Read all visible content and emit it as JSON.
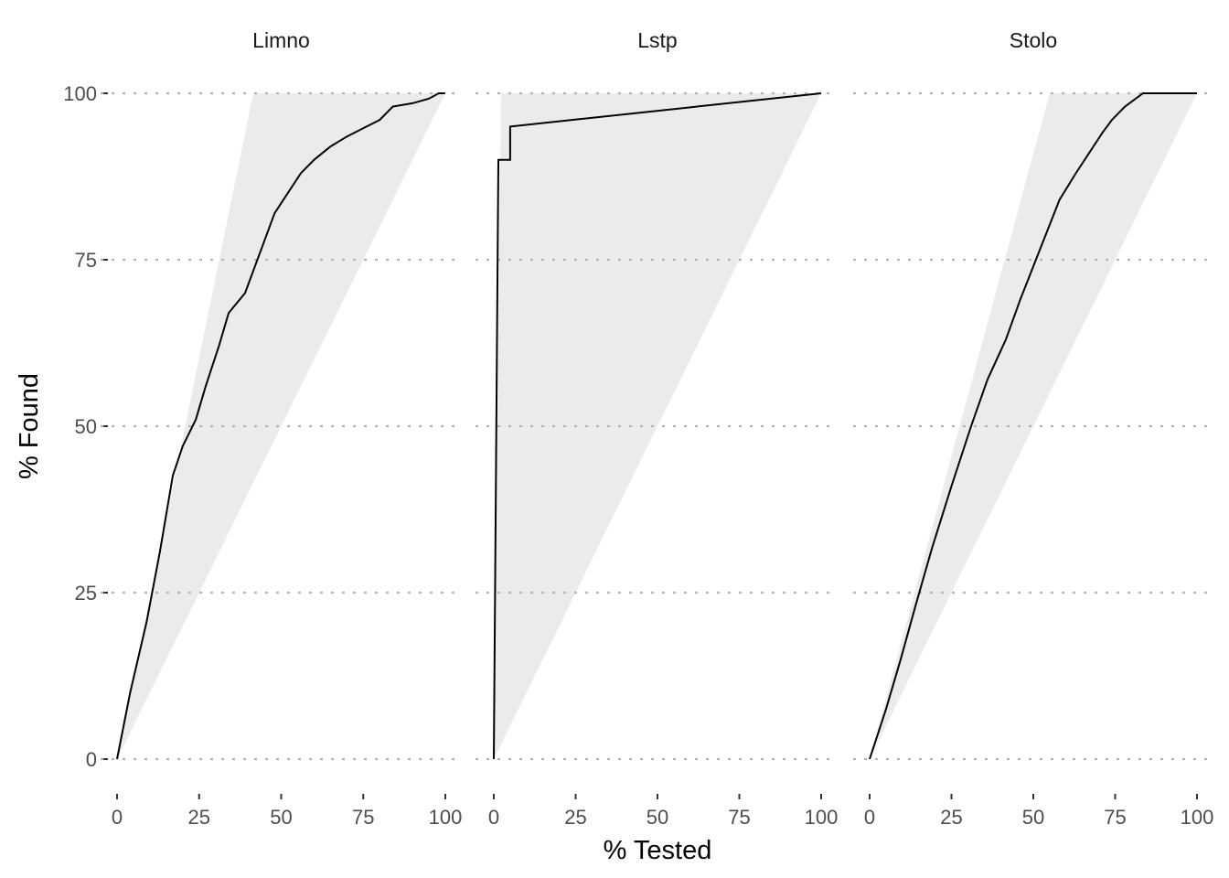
{
  "chart_data": {
    "type": "line",
    "layout": "faceted",
    "xlabel": "% Tested",
    "ylabel": "% Found",
    "xlim": [
      0,
      100
    ],
    "ylim": [
      0,
      100
    ],
    "x_ticks": [
      0,
      25,
      50,
      75,
      100
    ],
    "y_ticks": [
      0,
      25,
      50,
      75,
      100
    ],
    "grid": "horizontal-dotted",
    "colors": {
      "line": "#000000",
      "band": "#ebebeb",
      "grid": "#b3b3b3",
      "tick": "#333333",
      "tick_label": "#4d4d4d"
    },
    "panels": [
      {
        "title": "Limno",
        "band": [
          [
            0,
            0
          ],
          [
            41.5,
            100
          ],
          [
            100,
            100
          ]
        ],
        "x": [
          0,
          4,
          9,
          13,
          17,
          20,
          24,
          27,
          31,
          34,
          39,
          42,
          45,
          48,
          52,
          56,
          60,
          65,
          70,
          76,
          80,
          84,
          90,
          95,
          98,
          100
        ],
        "y": [
          0,
          10,
          20.6,
          31,
          42.6,
          47,
          51,
          56,
          62,
          67,
          70,
          74,
          78,
          82,
          85,
          88,
          90,
          92,
          93.5,
          95,
          96,
          98,
          98.5,
          99.2,
          100,
          100
        ]
      },
      {
        "title": "Lstp",
        "band": [
          [
            0,
            0
          ],
          [
            2.2,
            100
          ],
          [
            100,
            100
          ]
        ],
        "x": [
          0,
          1.4,
          1.4,
          5,
          5,
          100
        ],
        "y": [
          0,
          90,
          90,
          90,
          95,
          100
        ]
      },
      {
        "title": "Stolo",
        "band": [
          [
            0,
            0
          ],
          [
            55,
            100
          ],
          [
            100,
            100
          ]
        ],
        "x": [
          0,
          5,
          9.5,
          14,
          19,
          25,
          31,
          36,
          41.6,
          46,
          50,
          54,
          58,
          63,
          67,
          71,
          74,
          78,
          83.5,
          90,
          100
        ],
        "y": [
          0,
          7.5,
          15,
          23,
          31.6,
          41,
          50,
          57,
          63,
          69,
          74,
          79,
          84,
          88,
          91,
          94,
          96,
          98,
          100,
          100,
          100
        ]
      }
    ]
  }
}
